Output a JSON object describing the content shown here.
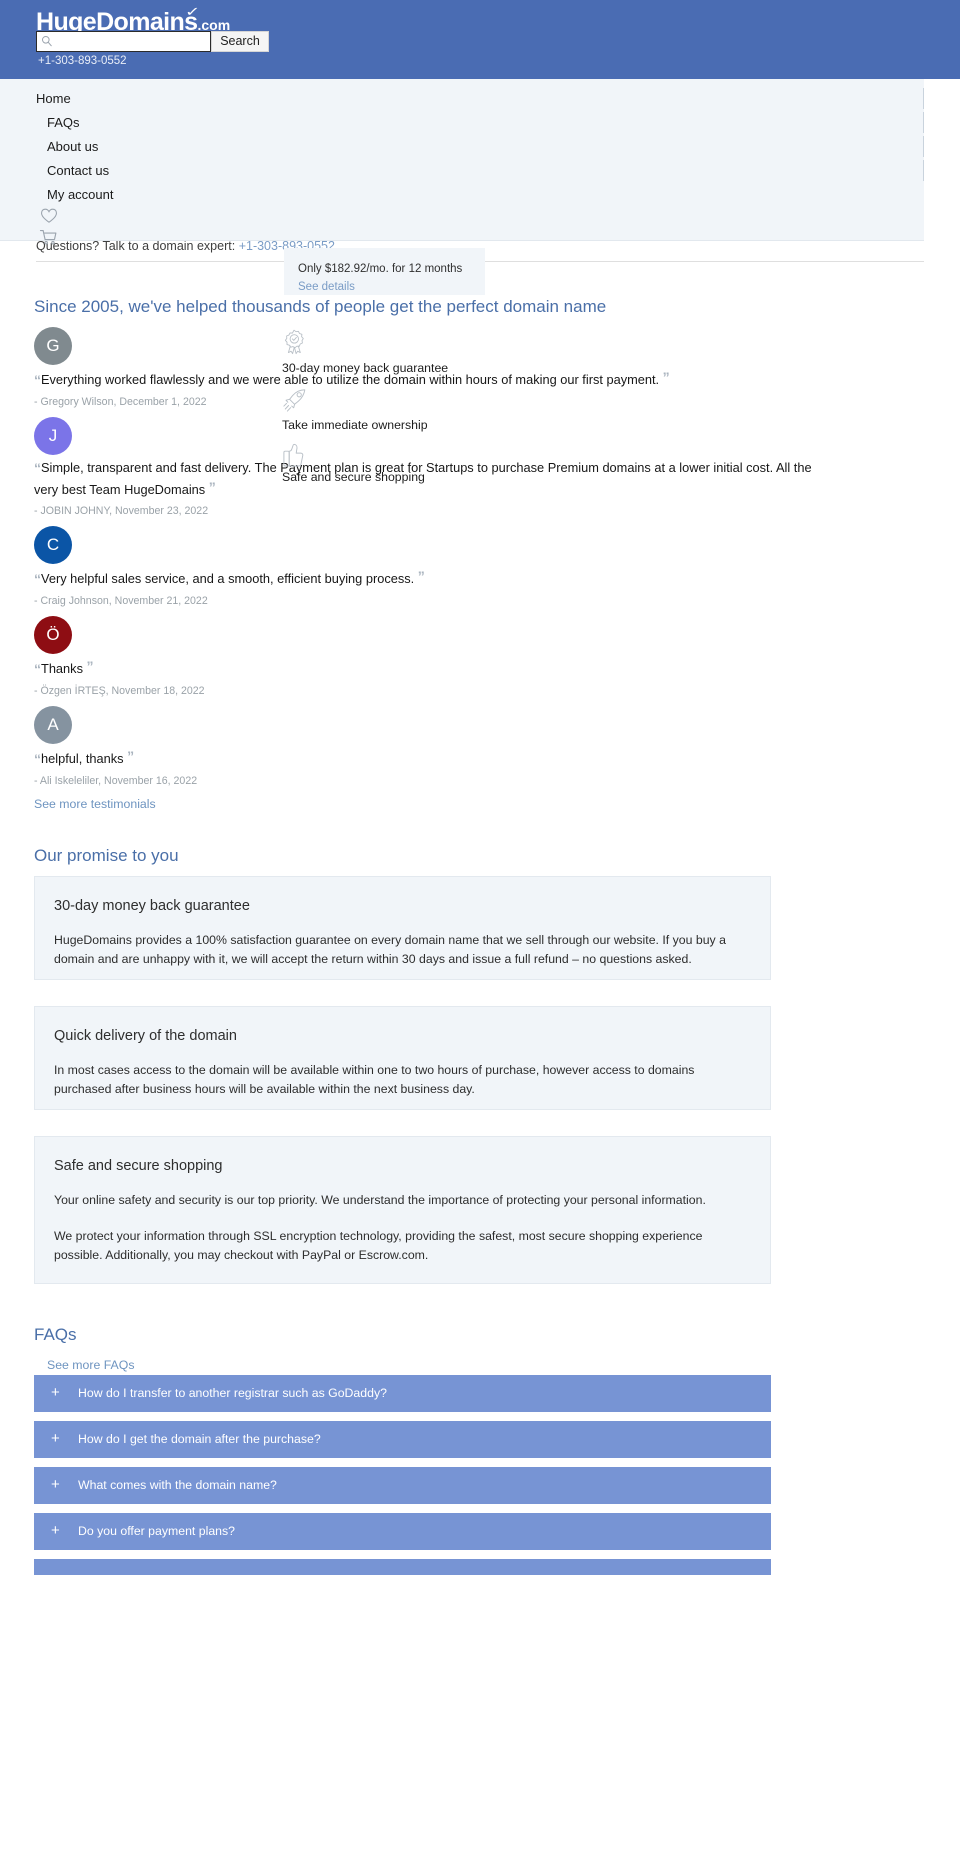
{
  "header": {
    "logo_main": "HugeDomains",
    "logo_suffix": ".com",
    "search_placeholder": "",
    "search_value": "",
    "search_button": "Search",
    "phone": "+1-303-893-0552",
    "accent_color": "#4a6cb3"
  },
  "nav": {
    "items": [
      {
        "label": "Home"
      },
      {
        "label": "FAQs"
      },
      {
        "label": "About us"
      },
      {
        "label": "Contact us"
      },
      {
        "label": "My account"
      }
    ],
    "wishlist_icon": "heart-icon",
    "cart_icon": "cart-icon"
  },
  "contact_bar": {
    "text": "Questions? Talk to a domain expert:",
    "phone": "+1-303-893-0552"
  },
  "price_popup": {
    "text": "Only $182.92/mo. for 12 months",
    "link": "See details"
  },
  "testimonials": {
    "title": "Since 2005, we've helped thousands of people get the perfect domain name",
    "quote_open": "“",
    "quote_close": "”",
    "see_more": "See more testimonials",
    "items": [
      {
        "initial": "G",
        "avatar_color": "#808a8f",
        "quote": "Everything worked flawlessly and we were able to utilize the domain within hours of making our first payment.",
        "author": "- Gregory Wilson, December 1, 2022"
      },
      {
        "initial": "J",
        "avatar_color": "#7b74e8",
        "quote": "Simple, transparent and fast delivery. The Payment plan is great for Startups to purchase Premium domains at a lower initial cost. All the very best Team HugeDomains",
        "author": "- JOBIN JOHNY, November 23, 2022"
      },
      {
        "initial": "C",
        "avatar_color": "#0b55a6",
        "quote": "Very helpful sales service, and a smooth, efficient buying process.",
        "author": "- Craig Johnson, November 21, 2022"
      },
      {
        "initial": "Ö",
        "avatar_color": "#8e0d13",
        "quote": "Thanks",
        "author": "- Özgen İRTEŞ, November 18, 2022"
      },
      {
        "initial": "A",
        "avatar_color": "#8593a0",
        "quote": "helpful, thanks",
        "author": "- Ali Iskeleliler, November 16, 2022"
      }
    ]
  },
  "features": [
    {
      "icon": "badge-check-icon",
      "label": "30-day money back guarantee"
    },
    {
      "icon": "rocket-icon",
      "label": "Take immediate ownership"
    },
    {
      "icon": "thumbs-up-icon",
      "label": "Safe and secure shopping"
    }
  ],
  "promise": {
    "title": "Our promise to you",
    "cards": [
      {
        "heading": "30-day money back guarantee",
        "paragraphs": [
          "HugeDomains provides a 100% satisfaction guarantee on every domain name that we sell through our website. If you buy a domain and are unhappy with it, we will accept the return within 30 days and issue a full refund – no questions asked."
        ]
      },
      {
        "heading": "Quick delivery of the domain",
        "paragraphs": [
          "In most cases access to the domain will be available within one to two hours of purchase, however access to domains purchased after business hours will be available within the next business day."
        ]
      },
      {
        "heading": "Safe and secure shopping",
        "paragraphs": [
          "Your online safety and security is our top priority. We understand the importance of protecting your personal information.",
          "We protect your information through SSL encryption technology, providing the safest, most secure shopping experience possible. Additionally, you may checkout with PayPal or Escrow.com."
        ]
      }
    ]
  },
  "faq": {
    "title": "FAQs",
    "see_more": "See more FAQs",
    "expand_icon": "plus-icon",
    "items": [
      {
        "question": "How do I transfer to another registrar such as GoDaddy?"
      },
      {
        "question": "How do I get the domain after the purchase?"
      },
      {
        "question": "What comes with the domain name?"
      },
      {
        "question": "Do you offer payment plans?"
      },
      {
        "question": ""
      }
    ]
  }
}
